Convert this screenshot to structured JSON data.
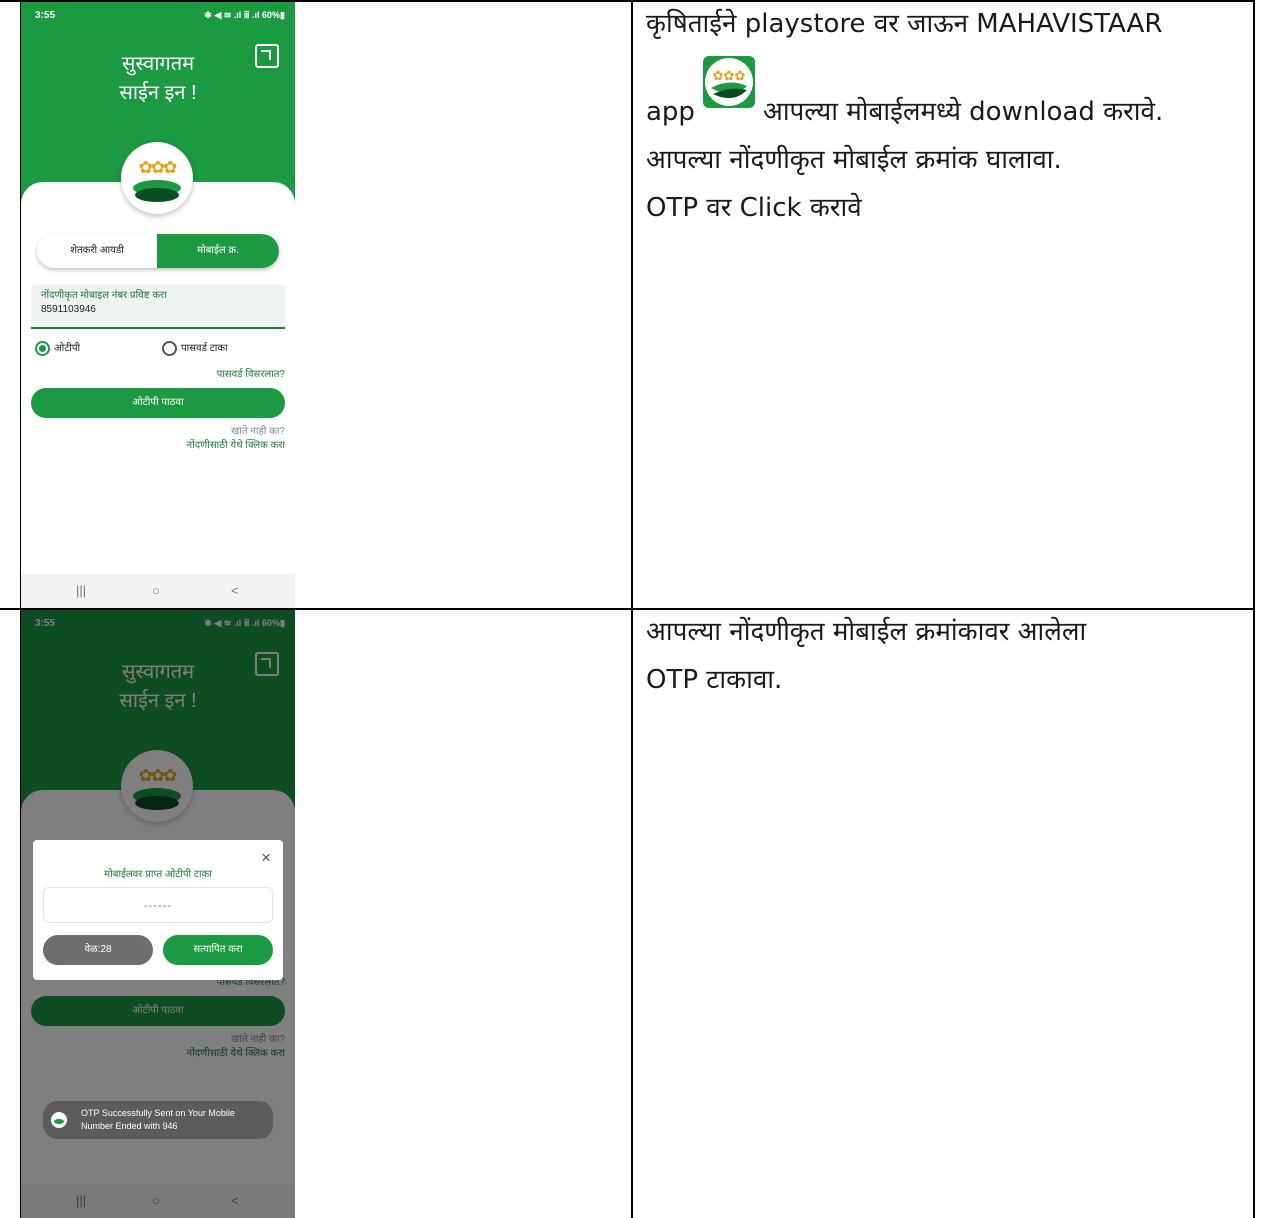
{
  "rows": [
    {
      "description": {
        "line1_prefix": "कृषिताईने playstore वर जाऊन MAHAVISTAAR",
        "line2_before_icon": "app",
        "line2_after_icon": "आपल्या मोबाईलमध्ये download करावे.",
        "line3": "आपल्या नोंदणीकृत मोबाईल क्रमांक घालावा.",
        "line4": "OTP वर Click करावे"
      },
      "phone": {
        "status_time": "3:55",
        "status_icons": "✱ ◀ ≋ .ıl ⅲ .ıl 60%▮",
        "welcome_line1": "सुस्वागतम",
        "welcome_line2": "साईन इन !",
        "tab_farmer_id": "शेतकरी आयडी",
        "tab_mobile_no": "मोबाईल क्र.",
        "mobile_field_label": "नोंदणीकृत मोबाइल नंबर प्रविष्ट करा",
        "mobile_field_value": "8591103946",
        "radio_otp_label": "ओटीपी",
        "radio_password_label": "पासवर्ड टाका",
        "forgot_password": "पासवर्ड विसरलात?",
        "send_otp_button": "ओटीपी पाठवा",
        "no_account": "खाते नाही का?",
        "register_link": "नोंदणीसाठी येथे क्लिक करा",
        "nav_recent": "|||",
        "nav_home": "○",
        "nav_back": "<"
      }
    },
    {
      "description": {
        "line1": "आपल्या नोंदणीकृत मोबाईल क्रमांकावर आलेला",
        "line2": "OTP टाकावा."
      },
      "phone": {
        "status_time": "3:55",
        "status_icons": "✱ ◀ ≋ .ıl ⅲ .ıl 60%▮",
        "welcome_line1": "सुस्वागतम",
        "welcome_line2": "साईन इन !",
        "dialog_title": "मोबाईलवर प्राप्त ओटीपी टाका",
        "dialog_close": "×",
        "otp_placeholder": "------",
        "timer_button": "वेळ:28",
        "verify_button": "सत्यापित करा",
        "forgot_password": "पासवर्ड विसरलात?",
        "send_otp_button": "ओटीपी पाठवा",
        "no_account": "खाते नाही का?",
        "register_link": "नोंदणीसाठी येथे क्लिक करा",
        "toast_line1": "OTP Successfully Sent on Your Mobile",
        "toast_line2": "Number Ended with 946",
        "nav_recent": "|||",
        "nav_home": "○",
        "nav_back": "<"
      }
    }
  ],
  "colors": {
    "brand_green": "#1c9a42",
    "dark_green": "#0b4d22",
    "wheat_gold": "#e3a21a"
  },
  "icons": [
    "translate-icon",
    "mahavistaar-logo-icon",
    "radio-selected-icon",
    "radio-unselected-icon",
    "close-icon"
  ]
}
